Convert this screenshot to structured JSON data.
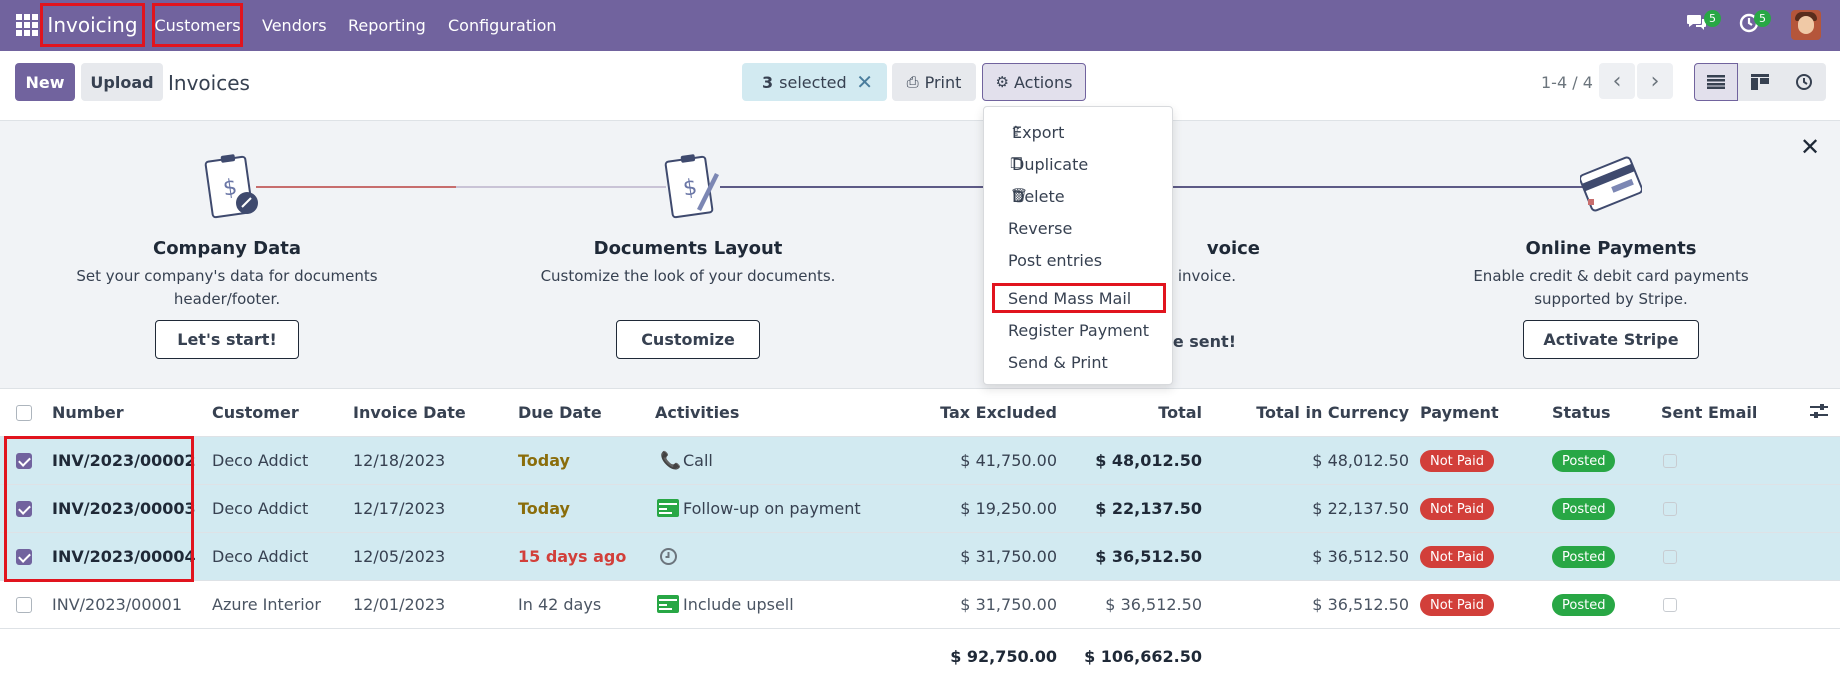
{
  "topnav": {
    "brand": "Invoicing",
    "items": [
      "Customers",
      "Vendors",
      "Reporting",
      "Configuration"
    ],
    "messages_count": "5",
    "activities_count": "5"
  },
  "control_panel": {
    "new_label": "New",
    "upload_label": "Upload",
    "title": "Invoices",
    "selected_count": "3",
    "selected_label": "selected",
    "print_label": "Print",
    "actions_label": "Actions",
    "pager": "1-4 / 4"
  },
  "onboarding": {
    "steps": [
      {
        "title": "Company Data",
        "desc1": "Set your company's data for documents",
        "desc2": "header/footer.",
        "button": "Let's start!"
      },
      {
        "title": "Documents Layout",
        "desc1": "Customize the look of your documents.",
        "desc2": "",
        "button": "Customize"
      },
      {
        "title": "voice",
        "desc1": "t invoice.",
        "desc2": "ce sent!",
        "button": ""
      },
      {
        "title": "Online Payments",
        "desc1": "Enable credit & debit card payments",
        "desc2": "supported by Stripe.",
        "button": "Activate Stripe"
      }
    ]
  },
  "actions_menu": {
    "items": [
      "Export",
      "Duplicate",
      "Delete",
      "Reverse",
      "Post entries",
      "Send Mass Mail",
      "Register Payment",
      "Send & Print"
    ]
  },
  "table": {
    "headers": [
      "Number",
      "Customer",
      "Invoice Date",
      "Due Date",
      "Activities",
      "Tax Excluded",
      "Total",
      "Total in Currency",
      "Payment",
      "Status",
      "Sent Email"
    ],
    "rows": [
      {
        "number": "INV/2023/00002",
        "customer": "Deco Addict",
        "invoice_date": "12/18/2023",
        "due_date": "Today",
        "activity": "Call",
        "tax_excluded": "$ 41,750.00",
        "total": "$ 48,012.50",
        "total_currency": "$ 48,012.50",
        "payment": "Not Paid",
        "status": "Posted",
        "selected": true
      },
      {
        "number": "INV/2023/00003",
        "customer": "Deco Addict",
        "invoice_date": "12/17/2023",
        "due_date": "Today",
        "activity": "Follow-up on payment",
        "tax_excluded": "$ 19,250.00",
        "total": "$ 22,137.50",
        "total_currency": "$ 22,137.50",
        "payment": "Not Paid",
        "status": "Posted",
        "selected": true
      },
      {
        "number": "INV/2023/00004",
        "customer": "Deco Addict",
        "invoice_date": "12/05/2023",
        "due_date": "15 days ago",
        "activity": "",
        "tax_excluded": "$ 31,750.00",
        "total": "$ 36,512.50",
        "total_currency": "$ 36,512.50",
        "payment": "Not Paid",
        "status": "Posted",
        "selected": true
      },
      {
        "number": "INV/2023/00001",
        "customer": "Azure Interior",
        "invoice_date": "12/01/2023",
        "due_date": "In 42 days",
        "activity": "Include upsell",
        "tax_excluded": "$ 31,750.00",
        "total": "$ 36,512.50",
        "total_currency": "$ 36,512.50",
        "payment": "Not Paid",
        "status": "Posted",
        "selected": false
      }
    ],
    "footer": {
      "tax_excluded": "$ 92,750.00",
      "total": "$ 106,662.50"
    }
  },
  "colors": {
    "brand": "#71639e",
    "selected_row": "#d2eaf1",
    "not_paid": "#d23f3a",
    "posted": "#28a745",
    "due_today": "#8a6d0b",
    "due_overdue": "#d23f3a",
    "highlight": "#e1141e"
  }
}
